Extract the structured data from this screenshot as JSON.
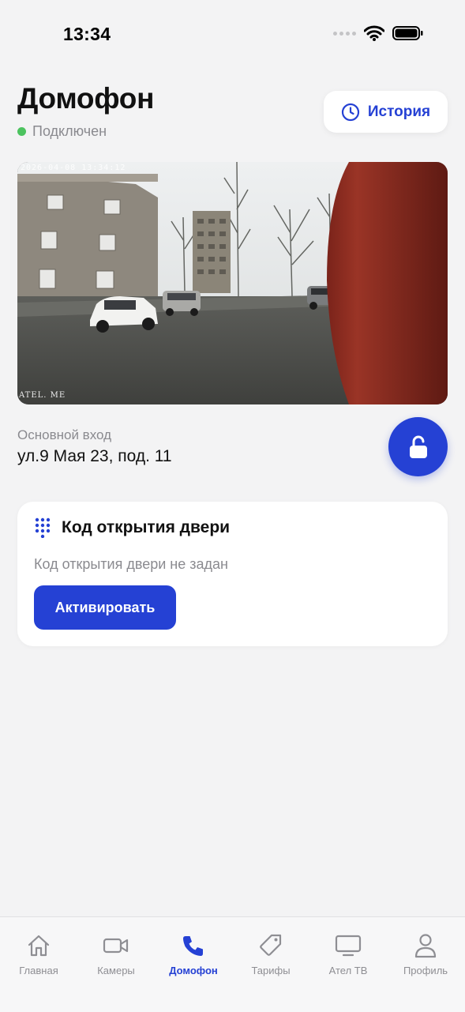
{
  "status_bar": {
    "time": "13:34"
  },
  "header": {
    "title": "Домофон",
    "status": "Подключен",
    "history_label": "История"
  },
  "camera": {
    "timestamp": "2026-04-08 13:34:12",
    "watermark": "ATEL. ME"
  },
  "entrance": {
    "label": "Основной вход",
    "address": "ул.9 Мая 23, под. 11"
  },
  "door_code": {
    "title": "Код открытия двери",
    "empty_text": "Код открытия двери не задан",
    "activate_label": "Активировать"
  },
  "tabbar": {
    "items": [
      {
        "label": "Главная",
        "icon": "home-icon"
      },
      {
        "label": "Камеры",
        "icon": "video-camera-icon"
      },
      {
        "label": "Домофон",
        "icon": "phone-icon",
        "active": true
      },
      {
        "label": "Тарифы",
        "icon": "tag-icon"
      },
      {
        "label": "Ател ТВ",
        "icon": "tv-icon"
      },
      {
        "label": "Профиль",
        "icon": "user-icon"
      }
    ]
  },
  "colors": {
    "accent": "#2541d4",
    "online": "#4cc35f",
    "background": "#f3f3f4",
    "muted_text": "#8a8a8f"
  }
}
